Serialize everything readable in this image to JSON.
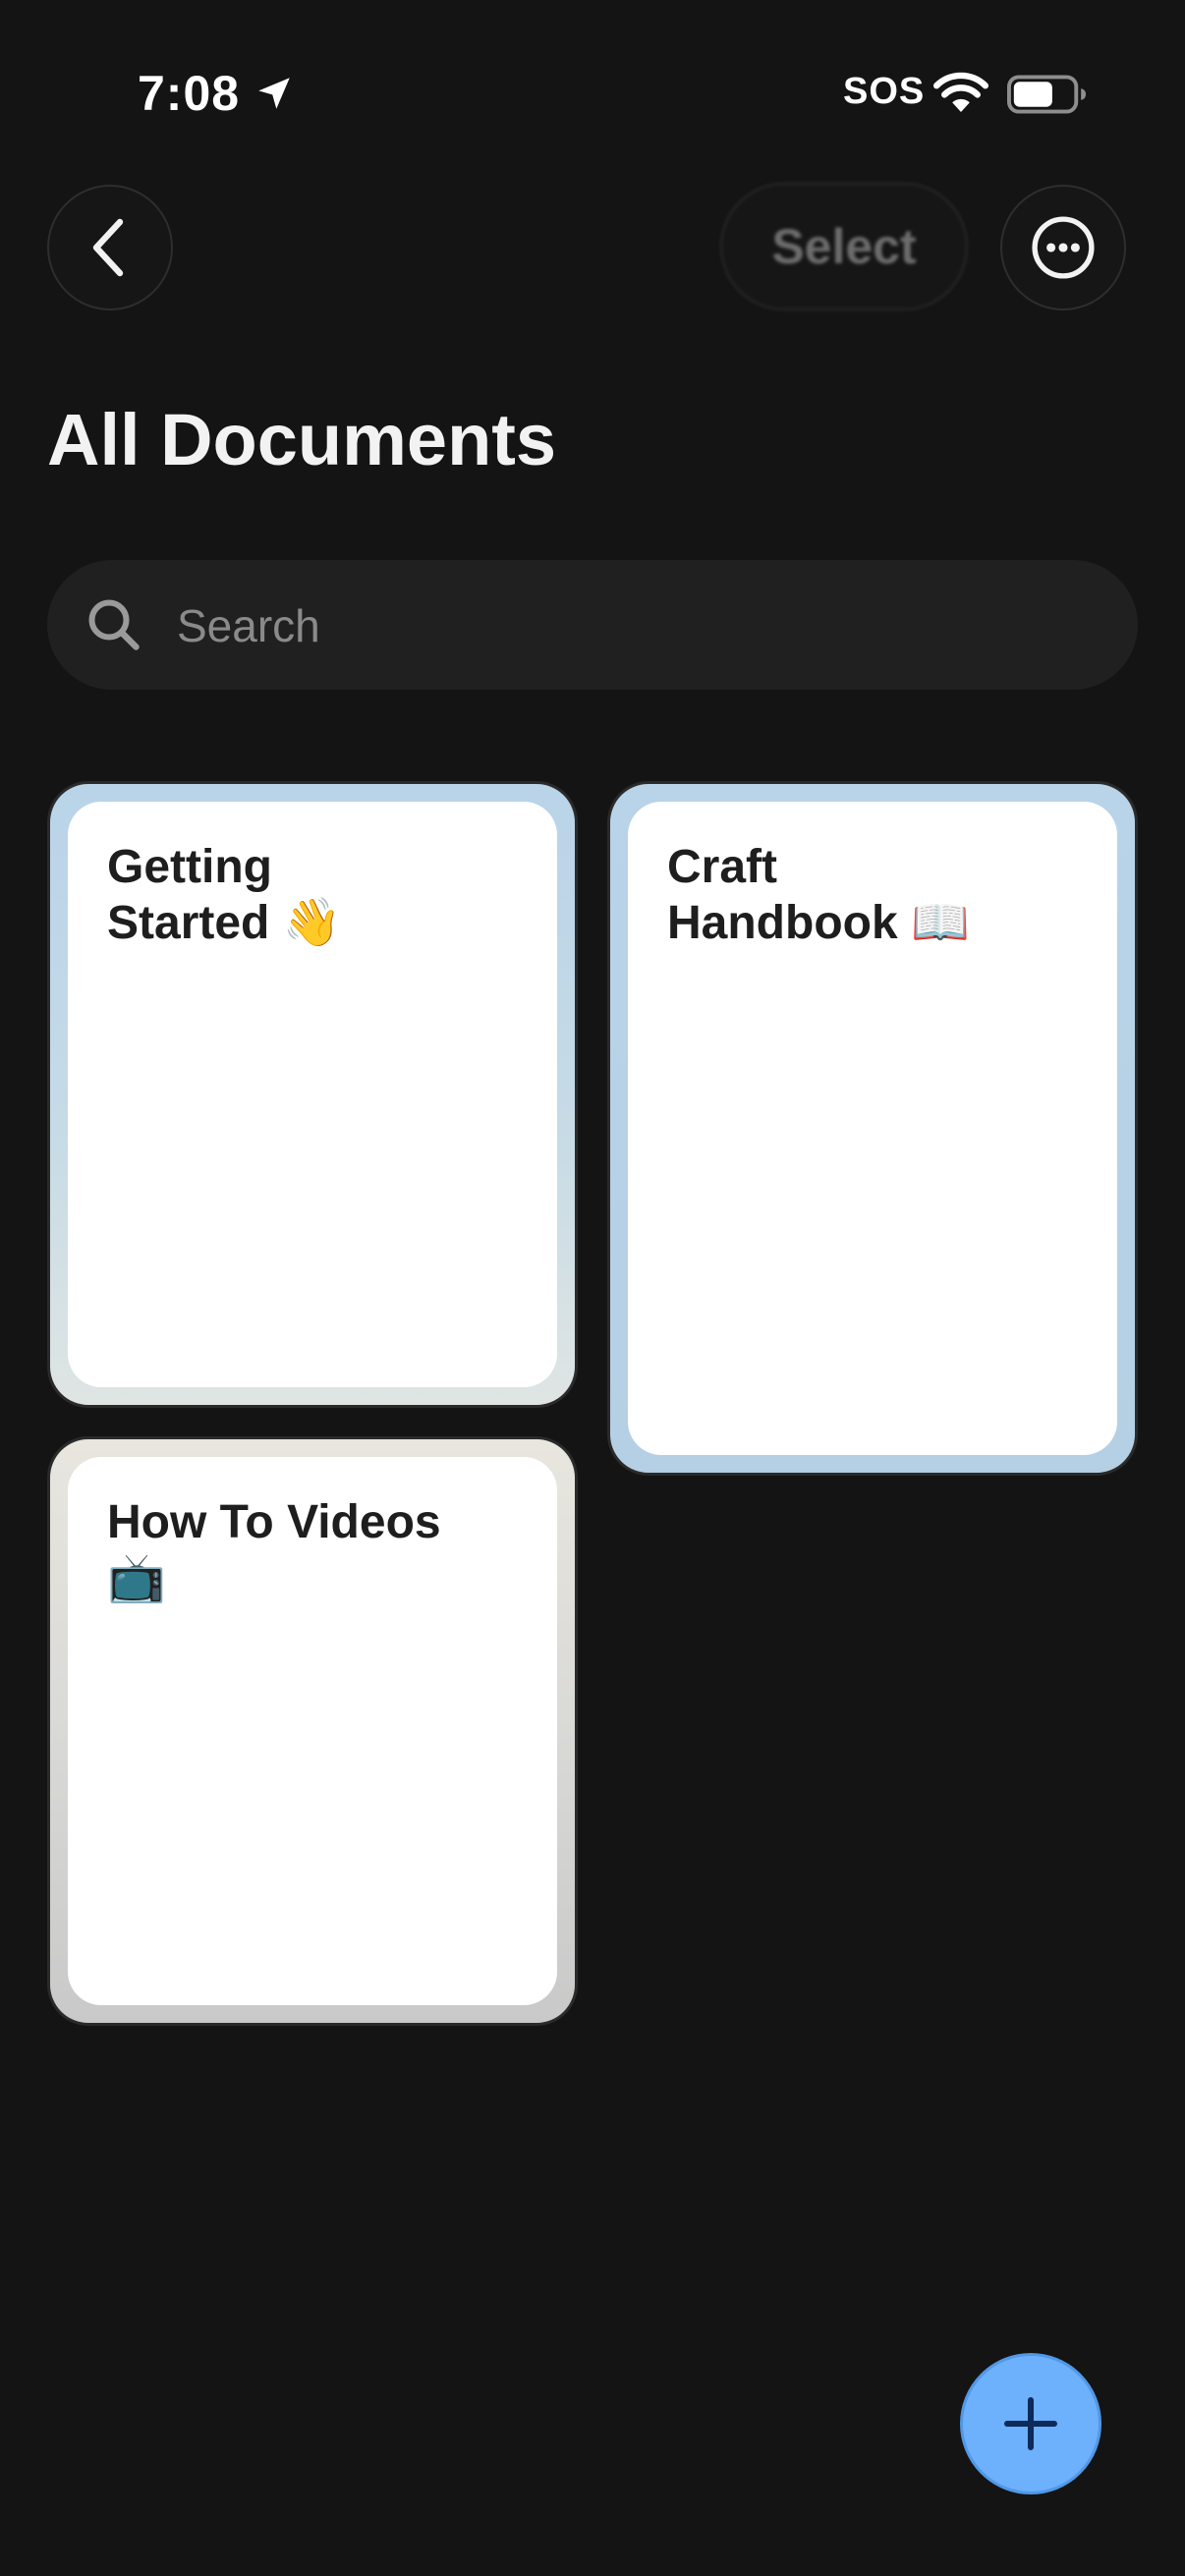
{
  "status_bar": {
    "time": "7:08",
    "carrier": "SOS",
    "icons": [
      "location-arrow-icon",
      "wifi-icon",
      "battery-icon"
    ]
  },
  "nav": {
    "back_icon": "chevron-left-icon",
    "select_label": "Select",
    "more_icon": "ellipsis-circle-icon"
  },
  "page_title": "All Documents",
  "search": {
    "placeholder": "Search",
    "value": "",
    "icon": "search-icon"
  },
  "documents": [
    {
      "title": "Getting\nStarted 👋",
      "cover_color": "#b9d3e8"
    },
    {
      "title": "Craft\nHandbook 📖",
      "cover_color": "#b9d3e8"
    },
    {
      "title": "How To Videos\n📺",
      "cover_color": "#e8e6df"
    }
  ],
  "fab": {
    "icon": "plus-icon",
    "color": "#6db0fb"
  }
}
